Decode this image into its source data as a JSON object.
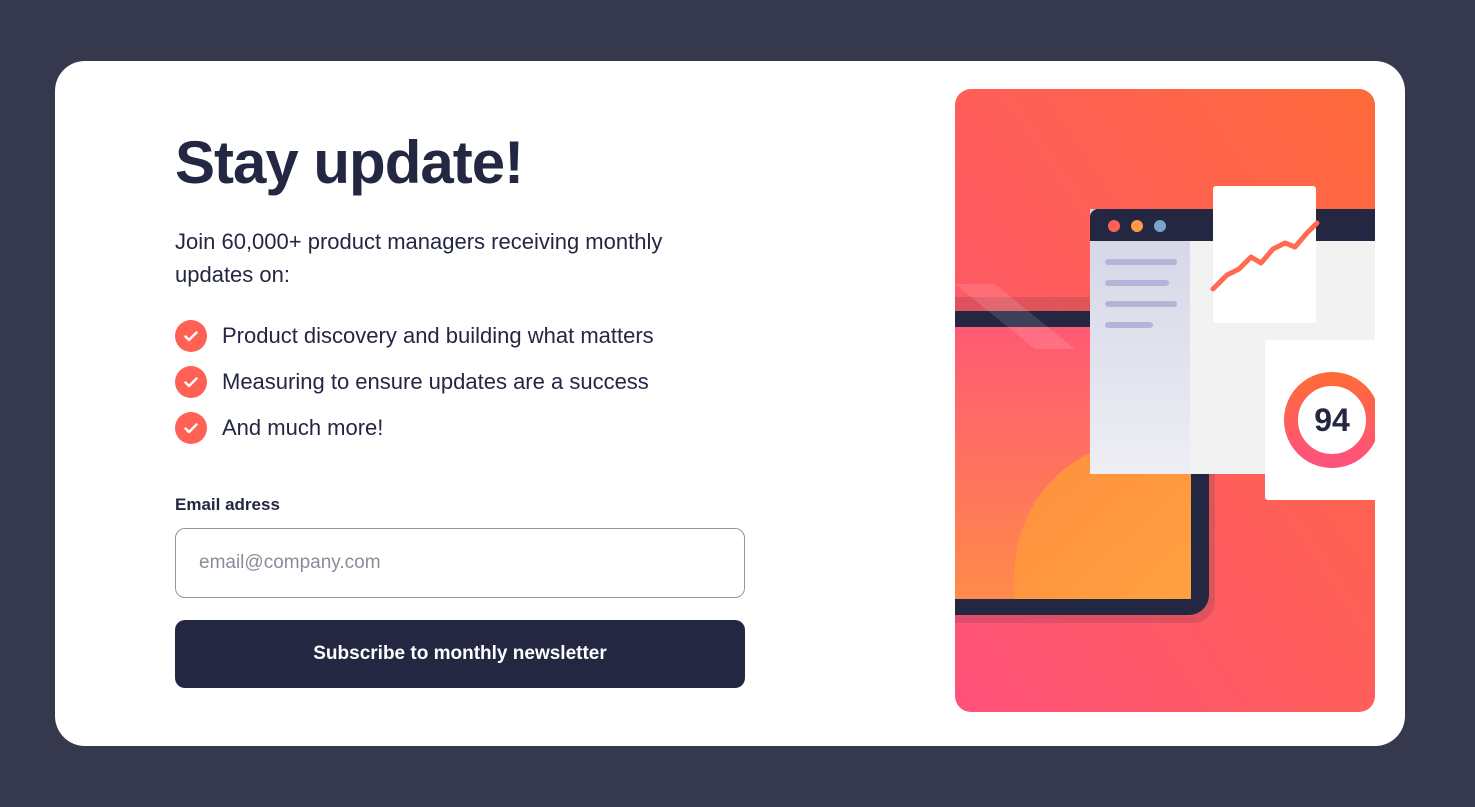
{
  "title": "Stay update!",
  "intro": "Join 60,000+ product managers receiving monthly updates on:",
  "features": [
    {
      "text": "Product discovery and building what matters"
    },
    {
      "text": "Measuring to ensure updates are a success"
    },
    {
      "text": "And much more!"
    }
  ],
  "form": {
    "email_label": "Email adress",
    "email_placeholder": "email@company.com",
    "email_value": "",
    "submit_label": "Subscribe to monthly newsletter"
  },
  "illustration": {
    "score": "94",
    "icons": [
      "check-icon",
      "trend-line-icon",
      "score-ring-icon"
    ]
  },
  "colors": {
    "page_bg": "#36384e",
    "card_bg": "#ffffff",
    "navy": "#242742",
    "tomato": "#ff6155",
    "gradient_start": "#ff6a3a",
    "gradient_end": "#ff527b"
  }
}
